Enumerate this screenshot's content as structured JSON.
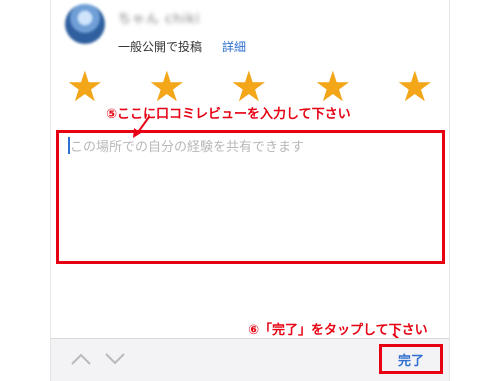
{
  "profile": {
    "username": "ちゃん chiki",
    "post_scope": "一般公開で投稿",
    "detail_link": "詳細"
  },
  "rating": {
    "value": 5,
    "max": 5,
    "star_glyph": "★",
    "star_color": "#f2a618"
  },
  "annotations": {
    "review_instruction": "⑤ここに口コミレビューを入力して下さい",
    "done_instruction": "⑥「完了」をタップして下さい",
    "highlight_color": "#e60012"
  },
  "review": {
    "value": "",
    "placeholder": "この場所での自分の経験を共有できます"
  },
  "toolbar": {
    "done_label": "完了",
    "previous_icon": "chevron-up-icon",
    "next_icon": "chevron-down-icon"
  }
}
